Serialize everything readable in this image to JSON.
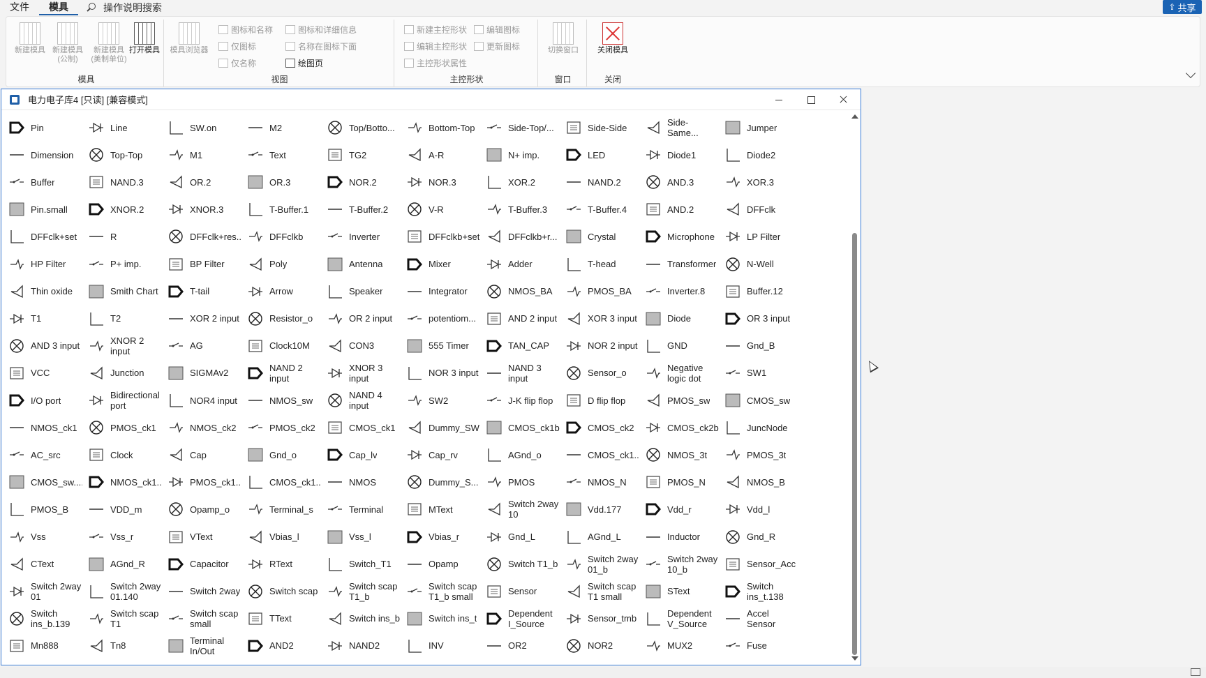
{
  "menu": {
    "tabs": [
      "文件",
      "模具"
    ],
    "active_tab": 1,
    "tell_me": "操作说明搜索",
    "share": "共享"
  },
  "ribbon": {
    "groups": [
      {
        "label": "模具",
        "big_buttons": [
          {
            "label": "新建模具",
            "enabled": false
          },
          {
            "label": "新建模具(公制)",
            "enabled": false
          },
          {
            "label": "新建模具(美制单位)",
            "enabled": false
          },
          {
            "label": "打开模具",
            "enabled": true
          }
        ]
      },
      {
        "label": "视图",
        "big_buttons": [
          {
            "label": "模具浏览器",
            "enabled": false
          }
        ],
        "small_buttons": [
          {
            "label": "图标和名称",
            "enabled": false
          },
          {
            "label": "仅图标",
            "enabled": false
          },
          {
            "label": "仅名称",
            "enabled": false
          },
          {
            "label": "图标和详细信息",
            "enabled": false
          },
          {
            "label": "名称在图标下面",
            "enabled": false
          },
          {
            "label": "绘图页",
            "enabled": true
          }
        ]
      },
      {
        "label": "主控形状",
        "small_buttons": [
          {
            "label": "新建主控形状",
            "enabled": false
          },
          {
            "label": "编辑主控形状",
            "enabled": false
          },
          {
            "label": "主控形状属性",
            "enabled": false
          },
          {
            "label": "编辑图标",
            "enabled": false
          },
          {
            "label": "更新图标",
            "enabled": false
          }
        ]
      },
      {
        "label": "窗口",
        "big_buttons": [
          {
            "label": "切换窗口",
            "enabled": false
          }
        ]
      },
      {
        "label": "关闭",
        "big_buttons": [
          {
            "label": "关闭模具",
            "enabled": true
          }
        ]
      }
    ]
  },
  "stencil": {
    "title": "电力电子库4 [只读] [兼容模式]",
    "columns": 10,
    "shapes": [
      "Pin",
      "Line",
      "SW.on",
      "M2",
      "Top/Botto...",
      "Bottom-Top",
      "Side-Top/...",
      "Side-Side",
      "Side-Same...",
      "Jumper",
      "Dimension",
      "Top-Top",
      "M1",
      "Text",
      "TG2",
      "A-R",
      "N+ imp.",
      "LED",
      "Diode1",
      "Diode2",
      "Buffer",
      "NAND.3",
      "OR.2",
      "OR.3",
      "NOR.2",
      "NOR.3",
      "XOR.2",
      "NAND.2",
      "AND.3",
      "XOR.3",
      "Pin.small",
      "XNOR.2",
      "XNOR.3",
      "T-Buffer.1",
      "T-Buffer.2",
      "V-R",
      "T-Buffer.3",
      "T-Buffer.4",
      "AND.2",
      "DFFclk",
      "DFFclk+set",
      "R",
      "DFFclk+res...",
      "DFFclkb",
      "Inverter",
      "DFFclkb+set",
      "DFFclkb+r...",
      "Crystal",
      "Microphone",
      "LP Filter",
      "HP Filter",
      "P+ imp.",
      "BP Filter",
      "Poly",
      "Antenna",
      "Mixer",
      "Adder",
      "T-head",
      "Transformer",
      "N-Well",
      "Thin oxide",
      "Smith Chart",
      "T-tail",
      "Arrow",
      "Speaker",
      "Integrator",
      "NMOS_BA",
      "PMOS_BA",
      "Inverter.8",
      "Buffer.12",
      "T1",
      "T2",
      "XOR 2 input",
      "Resistor_o",
      "OR 2 input",
      "potentiom...",
      "AND 2 input",
      "XOR 3 input",
      "Diode",
      "OR 3 input",
      "AND 3 input",
      "XNOR 2 input",
      "AG",
      "Clock10M",
      "CON3",
      "555 Timer",
      "TAN_CAP",
      "NOR 2 input",
      "GND",
      "Gnd_B",
      "VCC",
      "Junction",
      "SIGMAv2",
      "NAND 2 input",
      "XNOR 3 input",
      "NOR 3 input",
      "NAND 3 input",
      "Sensor_o",
      "Negative logic dot",
      "SW1",
      "I/O port",
      "Bidirectional port",
      "NOR4 input",
      "NMOS_sw",
      "NAND 4 input",
      "SW2",
      "J-K flip flop",
      "D flip flop",
      "PMOS_sw",
      "CMOS_sw",
      "NMOS_ck1",
      "PMOS_ck1",
      "NMOS_ck2",
      "PMOS_ck2",
      "CMOS_ck1",
      "Dummy_SW",
      "CMOS_ck1b",
      "CMOS_ck2",
      "CMOS_ck2b",
      "JuncNode",
      "AC_src",
      "Clock",
      "Cap",
      "Gnd_o",
      "Cap_lv",
      "Cap_rv",
      "AGnd_o",
      "CMOS_ck1...",
      "NMOS_3t",
      "PMOS_3t",
      "CMOS_sw....",
      "NMOS_ck1...",
      "PMOS_ck1...",
      "CMOS_ck1...",
      "NMOS",
      "Dummy_S...",
      "PMOS",
      "NMOS_N",
      "PMOS_N",
      "NMOS_B",
      "PMOS_B",
      "VDD_m",
      "Opamp_o",
      "Terminal_s",
      "Terminal",
      "MText",
      "Switch 2way 10",
      "Vdd.177",
      "Vdd_r",
      "Vdd_l",
      "Vss",
      "Vss_r",
      "VText",
      "Vbias_l",
      "Vss_l",
      "Vbias_r",
      "Gnd_L",
      "AGnd_L",
      "Inductor",
      "Gnd_R",
      "CText",
      "AGnd_R",
      "Capacitor",
      "RText",
      "Switch_T1",
      "Opamp",
      "Switch T1_b",
      "Switch 2way 01_b",
      "Switch 2way 10_b",
      "Sensor_Acc",
      "Switch 2way 01",
      "Switch 2way 01.140",
      "Switch 2way",
      "Switch scap",
      "Switch scap T1_b",
      "Switch scap T1_b small",
      "Sensor",
      "Switch scap T1 small",
      "SText",
      "Switch ins_t.138",
      "Switch ins_b.139",
      "Switch scap T1",
      "Switch scap small",
      "TText",
      "Switch ins_b",
      "Switch ins_t",
      "Dependent I_Source",
      "Sensor_tmb",
      "Dependent V_Source",
      "Accel Sensor",
      "Mn888",
      "Tn8",
      "Terminal In/Out",
      "AND2",
      "NAND2",
      "INV",
      "OR2",
      "NOR2",
      "MUX2",
      "Fuse"
    ]
  }
}
